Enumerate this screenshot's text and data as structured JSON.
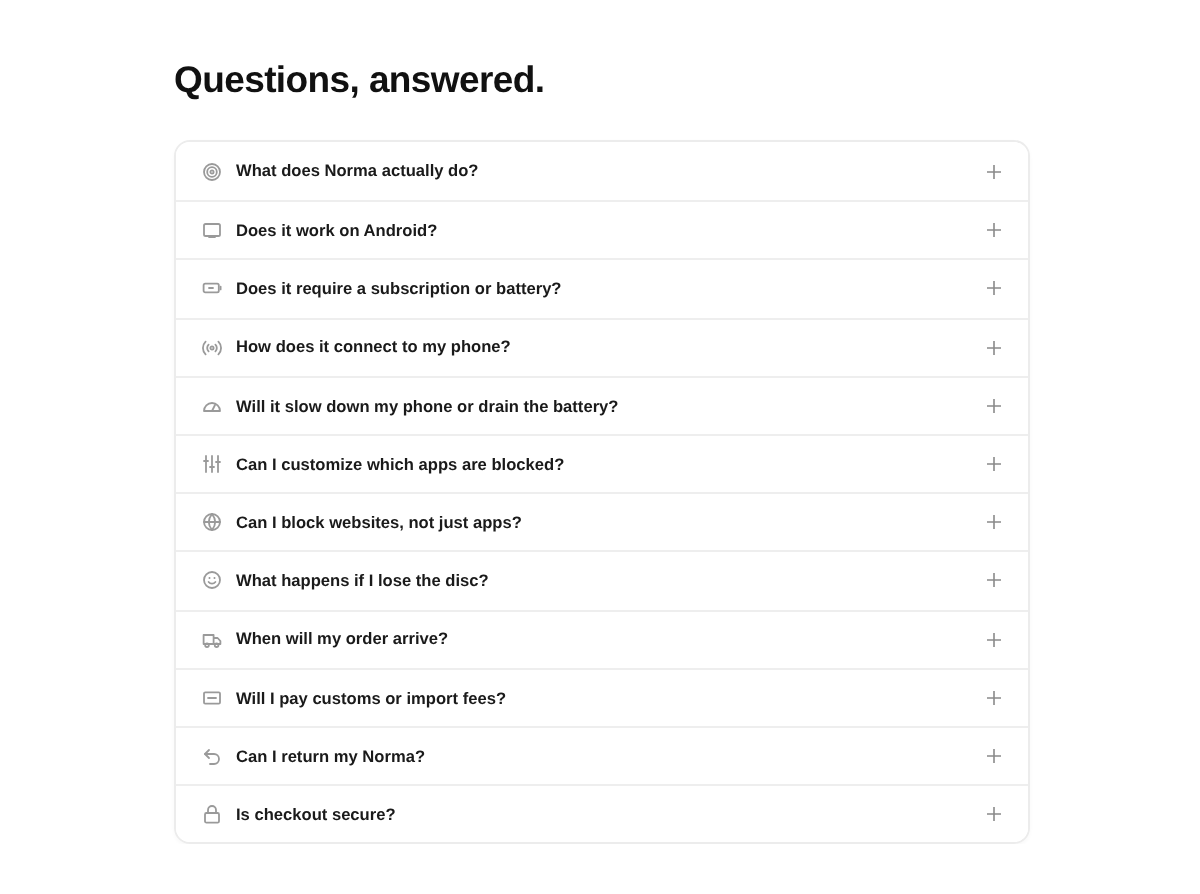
{
  "title": "Questions, answered.",
  "faq": [
    {
      "question": "What does Norma actually do?",
      "expanded": false
    },
    {
      "question": "Does it work on Android?",
      "expanded": false
    },
    {
      "question": "Does it require a subscription or battery?",
      "expanded": false
    },
    {
      "question": "How does it connect to my phone?",
      "expanded": false
    },
    {
      "question": "Will it slow down my phone or drain the battery?",
      "expanded": false
    },
    {
      "question": "Can I customize which apps are blocked?",
      "expanded": false
    },
    {
      "question": "Can I block websites, not just apps?",
      "expanded": false
    },
    {
      "question": "What happens if I lose the disc?",
      "expanded": false
    },
    {
      "question": "When will my order arrive?",
      "expanded": false
    },
    {
      "question": "Will I pay customs or import fees?",
      "expanded": false
    },
    {
      "question": "Can I return my Norma?",
      "expanded": false
    },
    {
      "question": "Is checkout secure?",
      "expanded": false
    }
  ]
}
